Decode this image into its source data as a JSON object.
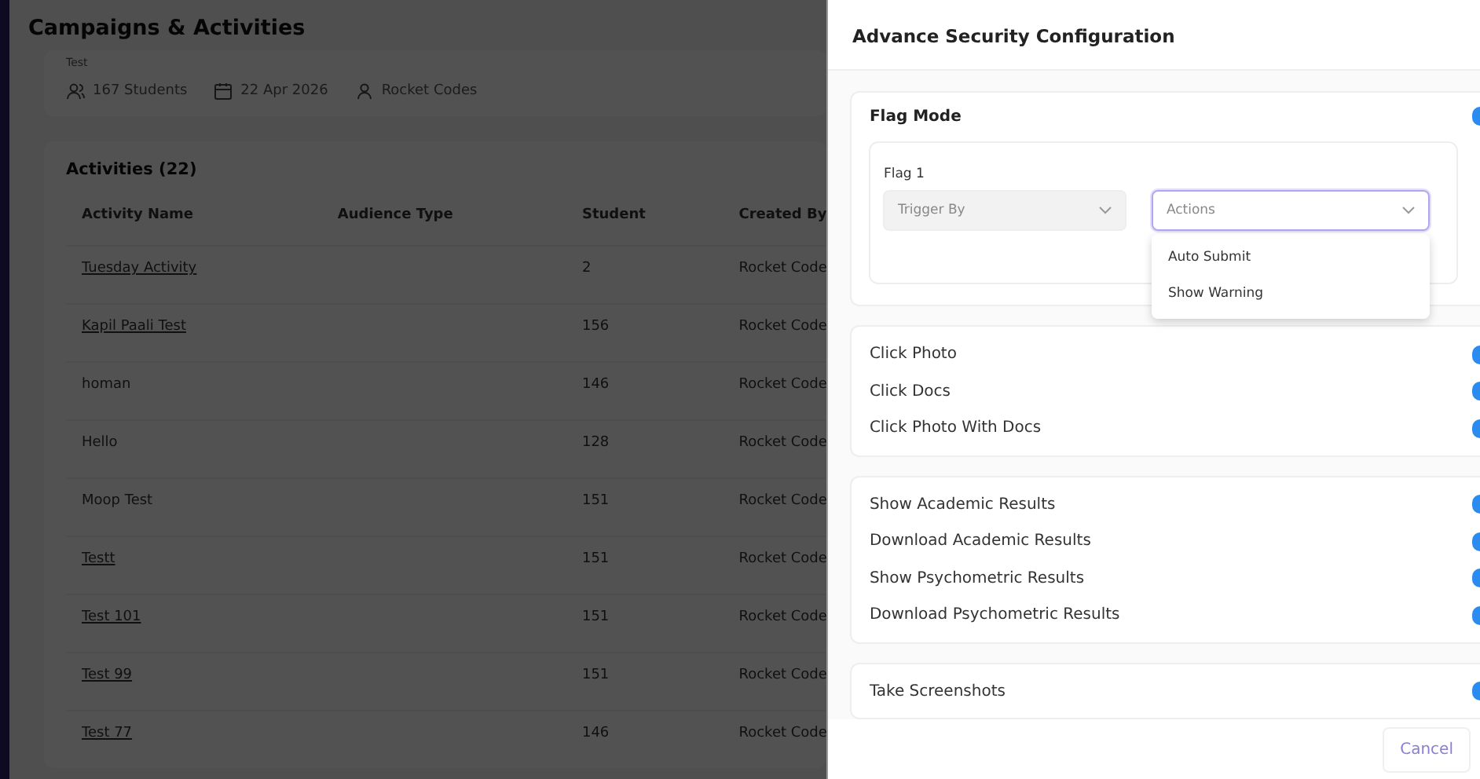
{
  "page": {
    "title": "Campaigns & Activities",
    "subtitle": "Test",
    "meta": [
      {
        "kind": "students",
        "text": "167 Students"
      },
      {
        "kind": "date",
        "text": "22 Apr 2026"
      },
      {
        "kind": "user",
        "text": "Rocket Codes"
      }
    ],
    "activities_title": "Activities (22)",
    "table": {
      "columns": [
        "Activity Name",
        "Audience Type",
        "Student",
        "Created By"
      ],
      "rows": [
        {
          "name": "Tuesday Activity",
          "linked": true,
          "audience": "",
          "student": "2",
          "created_by": "Rocket Code"
        },
        {
          "name": "Kapil Paali Test",
          "linked": true,
          "audience": "",
          "student": "156",
          "created_by": "Rocket Code"
        },
        {
          "name": "homan",
          "linked": false,
          "audience": "",
          "student": "146",
          "created_by": "Rocket Code"
        },
        {
          "name": "Hello",
          "linked": false,
          "audience": "",
          "student": "128",
          "created_by": "Rocket Code"
        },
        {
          "name": "Moop Test",
          "linked": false,
          "audience": "",
          "student": "151",
          "created_by": "Rocket Code"
        },
        {
          "name": "Testt",
          "linked": true,
          "audience": "",
          "student": "151",
          "created_by": "Rocket Code"
        },
        {
          "name": "Test 101",
          "linked": true,
          "audience": "",
          "student": "151",
          "created_by": "Rocket Code"
        },
        {
          "name": "Test 99",
          "linked": true,
          "audience": "",
          "student": "151",
          "created_by": "Rocket Code"
        },
        {
          "name": "Test 77",
          "linked": true,
          "audience": "",
          "student": "146",
          "created_by": "Rocket Code"
        }
      ]
    }
  },
  "drawer": {
    "title": "Advance Security Configuration",
    "flag_mode": {
      "label": "Flag Mode",
      "on": true,
      "flag": {
        "label": "Flag 1",
        "trigger": {
          "placeholder": "Trigger By",
          "disabled": true
        },
        "actions": {
          "placeholder": "Actions",
          "focused": true,
          "options": [
            "Auto Submit",
            "Show Warning"
          ]
        }
      }
    },
    "groups": [
      [
        {
          "label": "Click Photo",
          "on": true
        },
        {
          "label": "Click Docs",
          "on": true
        },
        {
          "label": "Click Photo With Docs",
          "on": true
        }
      ],
      [
        {
          "label": "Show Academic Results",
          "on": true
        },
        {
          "label": "Download Academic Results",
          "on": true
        },
        {
          "label": "Show Psychometric Results",
          "on": true
        },
        {
          "label": "Download Psychometric Results",
          "on": true
        }
      ],
      [
        {
          "label": "Take Screenshots",
          "on": true
        }
      ]
    ],
    "cancel": "Cancel"
  }
}
